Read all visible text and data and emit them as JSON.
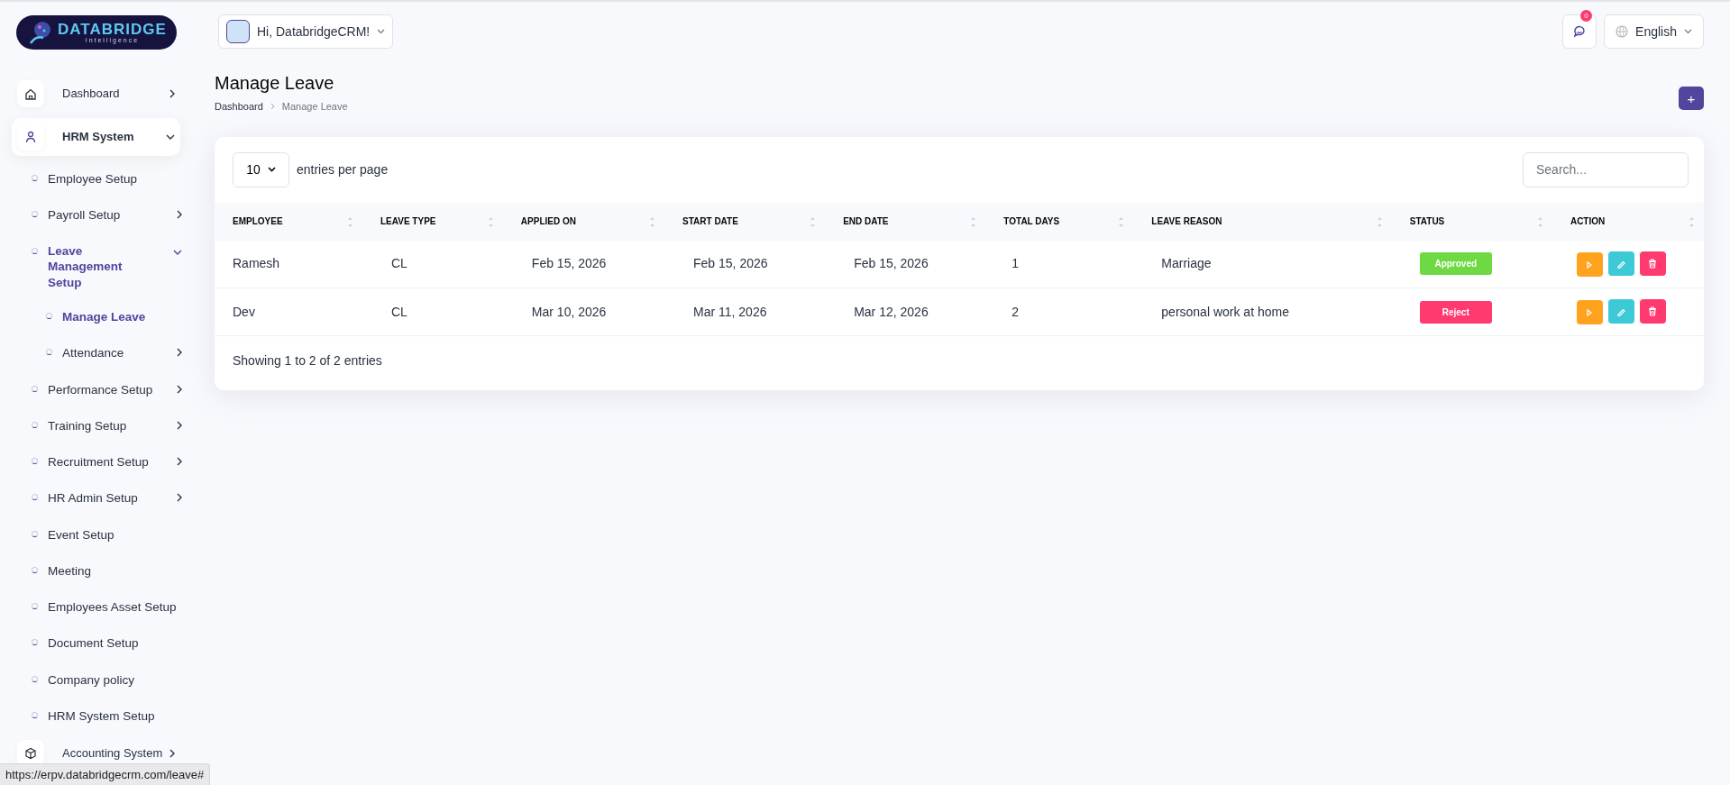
{
  "logo": {
    "title": "DATABRIDGE",
    "subtitle": "Intelligence"
  },
  "header": {
    "greeting": "Hi, DatabridgeCRM!",
    "notifications": "0",
    "language": "English"
  },
  "sidebar": {
    "items": [
      {
        "kind": "module",
        "label": "Dashboard",
        "selected": false,
        "expandable": true,
        "expanded": false
      },
      {
        "kind": "module",
        "label": "HRM System",
        "selected": true,
        "expandable": true,
        "expanded": true,
        "children": [
          {
            "kind": "link",
            "label": "Employee Setup",
            "selected": false,
            "expandable": false
          },
          {
            "kind": "link",
            "label": "Payroll Setup",
            "selected": false,
            "expandable": true,
            "expanded": false
          },
          {
            "kind": "link",
            "label": "Leave Management Setup",
            "selected": true,
            "expandable": true,
            "expanded": true,
            "children": [
              {
                "kind": "link",
                "label": "Manage Leave",
                "selected": true,
                "expandable": false
              },
              {
                "kind": "link",
                "label": "Attendance",
                "selected": false,
                "expandable": true,
                "expanded": false
              }
            ]
          },
          {
            "kind": "link",
            "label": "Performance Setup",
            "selected": false,
            "expandable": true,
            "expanded": false
          },
          {
            "kind": "link",
            "label": "Training Setup",
            "selected": false,
            "expandable": true,
            "expanded": false
          },
          {
            "kind": "link",
            "label": "Recruitment Setup",
            "selected": false,
            "expandable": true,
            "expanded": false
          },
          {
            "kind": "link",
            "label": "HR Admin Setup",
            "selected": false,
            "expandable": true,
            "expanded": false
          },
          {
            "kind": "link",
            "label": "Event Setup",
            "selected": false,
            "expandable": false
          },
          {
            "kind": "link",
            "label": "Meeting",
            "selected": false,
            "expandable": false
          },
          {
            "kind": "link",
            "label": "Employees Asset Setup",
            "selected": false,
            "expandable": false
          },
          {
            "kind": "link",
            "label": "Document Setup",
            "selected": false,
            "expandable": false
          },
          {
            "kind": "link",
            "label": "Company policy",
            "selected": false,
            "expandable": false
          },
          {
            "kind": "link",
            "label": "HRM System Setup",
            "selected": false,
            "expandable": false
          }
        ]
      },
      {
        "kind": "module",
        "label": "Accounting System",
        "selected": false,
        "expandable": true,
        "expanded": false
      }
    ]
  },
  "page": {
    "title": "Manage Leave",
    "breadcrumb": [
      "Dashboard",
      "Manage Leave"
    ],
    "add_button": "+"
  },
  "table": {
    "page_size": "10",
    "page_size_label": "entries per page",
    "search_placeholder": "Search...",
    "columns": [
      "EMPLOYEE",
      "LEAVE TYPE",
      "APPLIED ON",
      "START DATE",
      "END DATE",
      "TOTAL DAYS",
      "LEAVE REASON",
      "STATUS",
      "ACTION"
    ],
    "rows": [
      {
        "employee": "Ramesh",
        "leave_type": "CL",
        "applied_on": "Feb 15, 2026",
        "start_date": "Feb 15, 2026",
        "end_date": "Feb 15, 2026",
        "total_days": "1",
        "reason": "Marriage",
        "status": "Approved",
        "color": "#6fd943"
      },
      {
        "employee": "Dev",
        "leave_type": "CL",
        "applied_on": "Mar 10, 2026",
        "start_date": "Mar 11, 2026",
        "end_date": "Mar 12, 2026",
        "total_days": "2",
        "reason": "personal work at home",
        "status": "Reject",
        "color": "#ff3a6e"
      }
    ],
    "footer": "Showing 1 to 2 of 2 entries"
  },
  "status_url": "https://erpv.databridgecrm.com/leave#"
}
